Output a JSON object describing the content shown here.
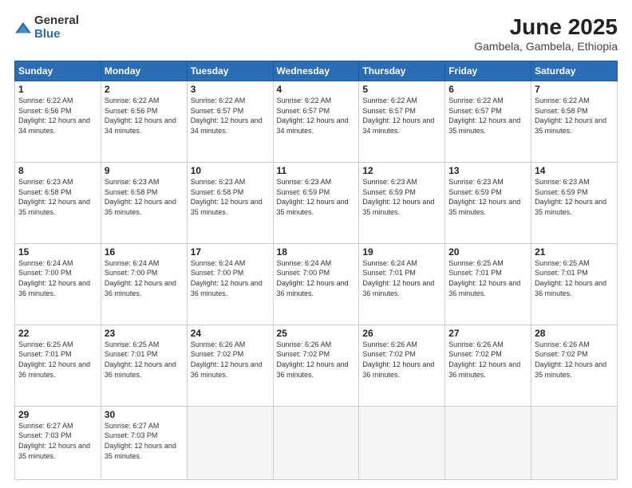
{
  "header": {
    "logo": {
      "general": "General",
      "blue": "Blue"
    },
    "title": "June 2025",
    "subtitle": "Gambela, Gambela, Ethiopia"
  },
  "calendar": {
    "days_of_week": [
      "Sunday",
      "Monday",
      "Tuesday",
      "Wednesday",
      "Thursday",
      "Friday",
      "Saturday"
    ],
    "weeks": [
      [
        null,
        {
          "day": "2",
          "sunrise": "6:22 AM",
          "sunset": "6:56 PM",
          "daylight": "12 hours and 34 minutes."
        },
        {
          "day": "3",
          "sunrise": "6:22 AM",
          "sunset": "6:57 PM",
          "daylight": "12 hours and 34 minutes."
        },
        {
          "day": "4",
          "sunrise": "6:22 AM",
          "sunset": "6:57 PM",
          "daylight": "12 hours and 34 minutes."
        },
        {
          "day": "5",
          "sunrise": "6:22 AM",
          "sunset": "6:57 PM",
          "daylight": "12 hours and 34 minutes."
        },
        {
          "day": "6",
          "sunrise": "6:22 AM",
          "sunset": "6:57 PM",
          "daylight": "12 hours and 35 minutes."
        },
        {
          "day": "7",
          "sunrise": "6:22 AM",
          "sunset": "6:58 PM",
          "daylight": "12 hours and 35 minutes."
        }
      ],
      [
        {
          "day": "1",
          "sunrise": "6:22 AM",
          "sunset": "6:56 PM",
          "daylight": "12 hours and 34 minutes."
        },
        {
          "day": "8",
          "sunrise": "6:23 AM",
          "sunset": "6:58 PM",
          "daylight": "12 hours and 35 minutes."
        },
        {
          "day": "9",
          "sunrise": "6:23 AM",
          "sunset": "6:58 PM",
          "daylight": "12 hours and 35 minutes."
        },
        {
          "day": "10",
          "sunrise": "6:23 AM",
          "sunset": "6:58 PM",
          "daylight": "12 hours and 35 minutes."
        },
        {
          "day": "11",
          "sunrise": "6:23 AM",
          "sunset": "6:59 PM",
          "daylight": "12 hours and 35 minutes."
        },
        {
          "day": "12",
          "sunrise": "6:23 AM",
          "sunset": "6:59 PM",
          "daylight": "12 hours and 35 minutes."
        },
        {
          "day": "13",
          "sunrise": "6:23 AM",
          "sunset": "6:59 PM",
          "daylight": "12 hours and 35 minutes."
        },
        {
          "day": "14",
          "sunrise": "6:23 AM",
          "sunset": "6:59 PM",
          "daylight": "12 hours and 35 minutes."
        }
      ],
      [
        {
          "day": "15",
          "sunrise": "6:24 AM",
          "sunset": "7:00 PM",
          "daylight": "12 hours and 36 minutes."
        },
        {
          "day": "16",
          "sunrise": "6:24 AM",
          "sunset": "7:00 PM",
          "daylight": "12 hours and 36 minutes."
        },
        {
          "day": "17",
          "sunrise": "6:24 AM",
          "sunset": "7:00 PM",
          "daylight": "12 hours and 36 minutes."
        },
        {
          "day": "18",
          "sunrise": "6:24 AM",
          "sunset": "7:00 PM",
          "daylight": "12 hours and 36 minutes."
        },
        {
          "day": "19",
          "sunrise": "6:24 AM",
          "sunset": "7:01 PM",
          "daylight": "12 hours and 36 minutes."
        },
        {
          "day": "20",
          "sunrise": "6:25 AM",
          "sunset": "7:01 PM",
          "daylight": "12 hours and 36 minutes."
        },
        {
          "day": "21",
          "sunrise": "6:25 AM",
          "sunset": "7:01 PM",
          "daylight": "12 hours and 36 minutes."
        }
      ],
      [
        {
          "day": "22",
          "sunrise": "6:25 AM",
          "sunset": "7:01 PM",
          "daylight": "12 hours and 36 minutes."
        },
        {
          "day": "23",
          "sunrise": "6:25 AM",
          "sunset": "7:01 PM",
          "daylight": "12 hours and 36 minutes."
        },
        {
          "day": "24",
          "sunrise": "6:26 AM",
          "sunset": "7:02 PM",
          "daylight": "12 hours and 36 minutes."
        },
        {
          "day": "25",
          "sunrise": "6:26 AM",
          "sunset": "7:02 PM",
          "daylight": "12 hours and 36 minutes."
        },
        {
          "day": "26",
          "sunrise": "6:26 AM",
          "sunset": "7:02 PM",
          "daylight": "12 hours and 36 minutes."
        },
        {
          "day": "27",
          "sunrise": "6:26 AM",
          "sunset": "7:02 PM",
          "daylight": "12 hours and 36 minutes."
        },
        {
          "day": "28",
          "sunrise": "6:26 AM",
          "sunset": "7:02 PM",
          "daylight": "12 hours and 35 minutes."
        }
      ],
      [
        {
          "day": "29",
          "sunrise": "6:27 AM",
          "sunset": "7:03 PM",
          "daylight": "12 hours and 35 minutes."
        },
        {
          "day": "30",
          "sunrise": "6:27 AM",
          "sunset": "7:03 PM",
          "daylight": "12 hours and 35 minutes."
        },
        null,
        null,
        null,
        null,
        null
      ]
    ]
  }
}
